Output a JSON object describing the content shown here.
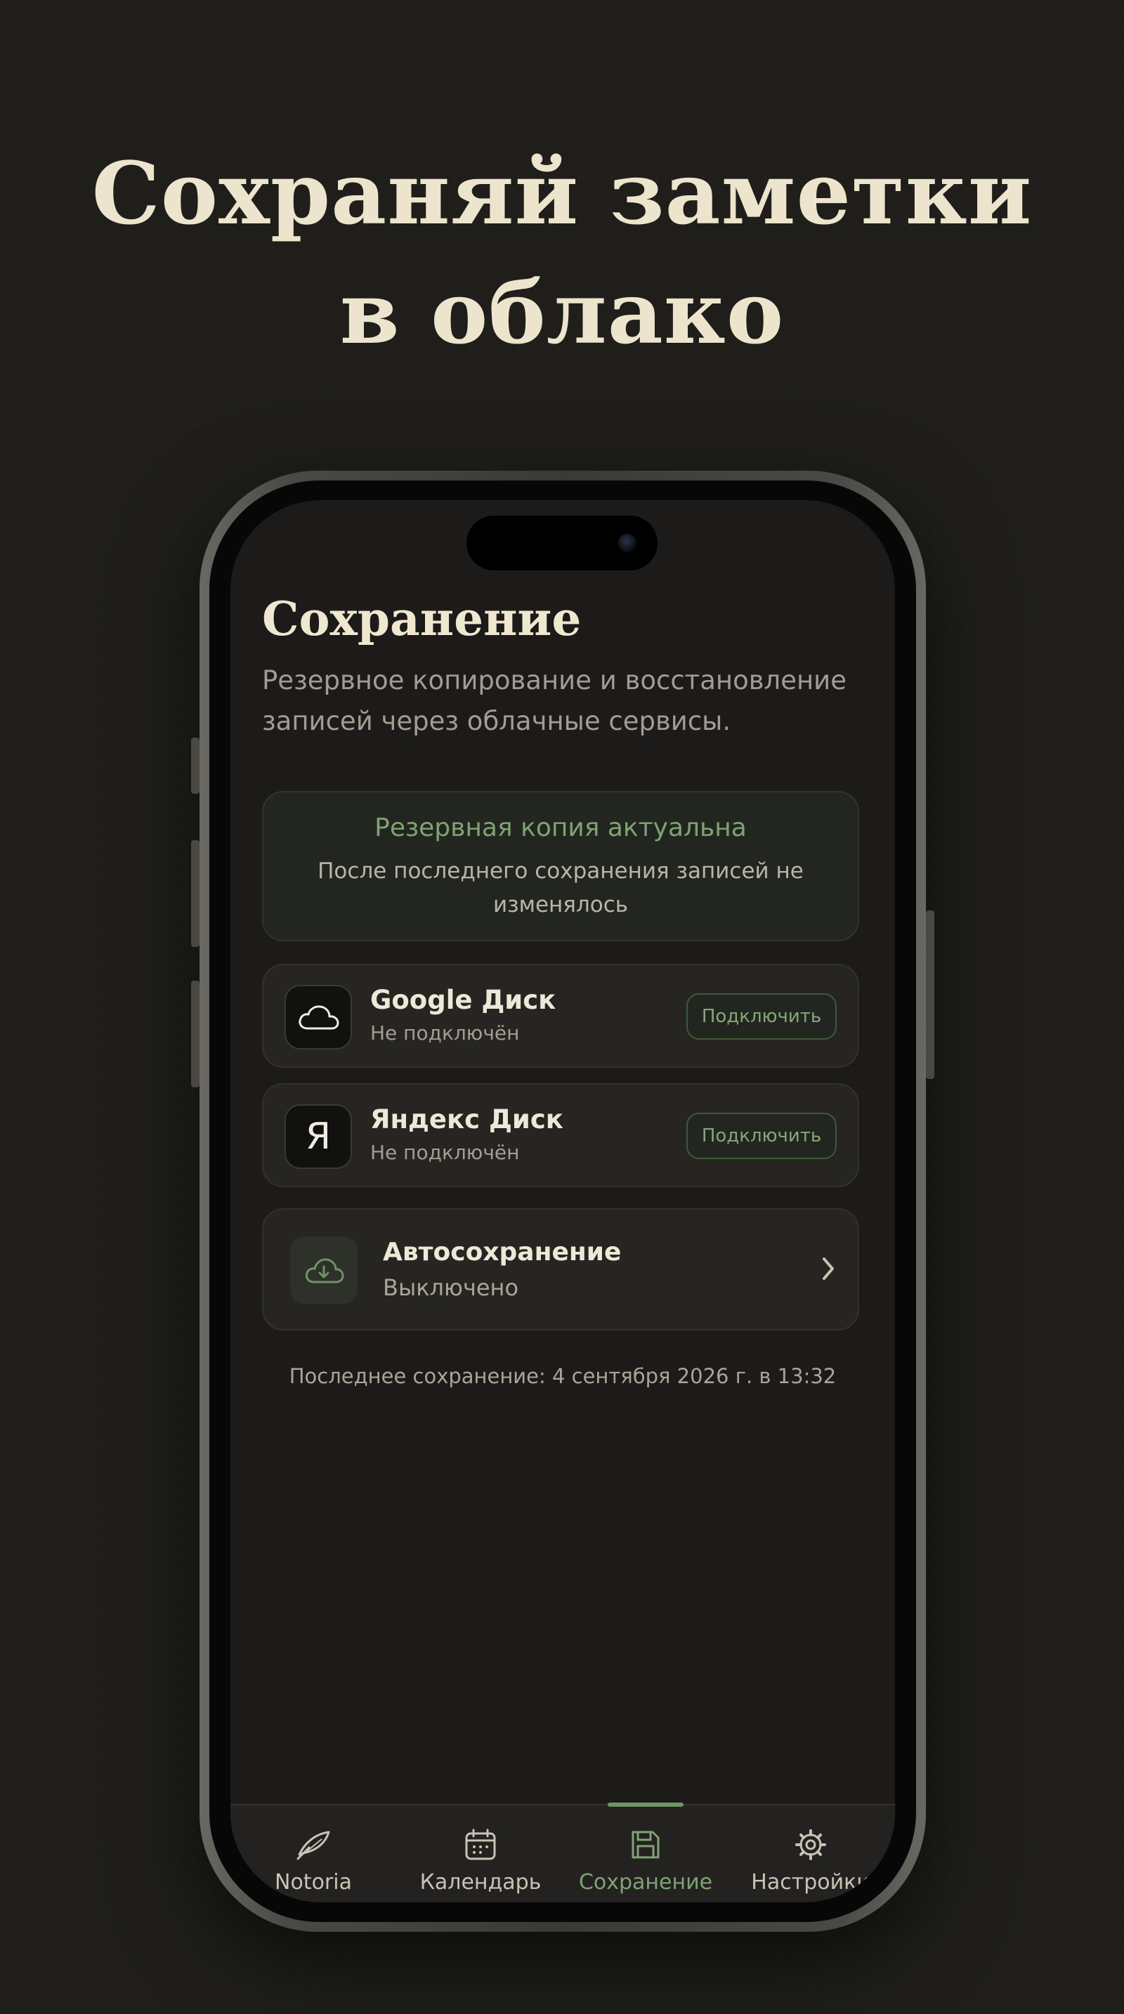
{
  "promo": {
    "headline_line1": "Сохраняй заметки",
    "headline_line2": "в облако"
  },
  "screen": {
    "title": "Сохранение",
    "subtitle": "Резервное копирование и восстановление записей через облачные сервисы.",
    "status": {
      "title": "Резервная копия актуальна",
      "text": "После последнего сохранения записей не изменялось"
    },
    "services": [
      {
        "icon": "cloud-icon",
        "name": "Google Диск",
        "state": "Не подключён",
        "button": "Подключить"
      },
      {
        "icon": "yandex-logo",
        "letter": "Я",
        "name": "Яндекс Диск",
        "state": "Не подключён",
        "button": "Подключить"
      }
    ],
    "autosave": {
      "icon": "cloud-download-icon",
      "title": "Автосохранение",
      "state": "Выключено"
    },
    "last_save": "Последнее сохранение: 4 сентября 2026 г. в 13:32"
  },
  "tabbar": {
    "active": "Сохранение",
    "tabs": [
      {
        "label": "Notoria",
        "icon": "quill-icon"
      },
      {
        "label": "Календарь",
        "icon": "calendar-icon"
      },
      {
        "label": "Сохранение",
        "icon": "save-icon"
      },
      {
        "label": "Настройки",
        "icon": "gear-icon"
      }
    ]
  },
  "colors": {
    "background": "#1f1e1b",
    "headline": "#ece4cc",
    "accent_green": "#7fa373",
    "card": "#262522"
  }
}
